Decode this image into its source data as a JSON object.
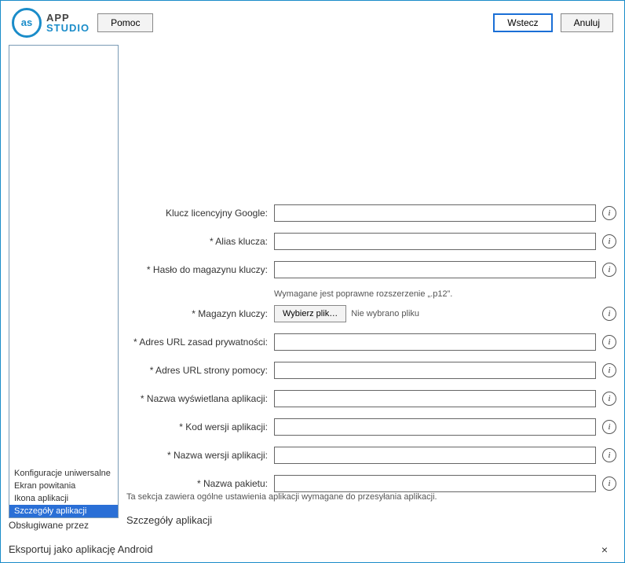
{
  "window": {
    "title": "Eksportuj jako aplikację Android"
  },
  "sidebar": {
    "label": "Obsługiwane przez",
    "items": [
      {
        "label": "Szczegóły aplikacji",
        "selected": true
      },
      {
        "label": "Ikona aplikacji"
      },
      {
        "label": "Ekran powitania"
      },
      {
        "label": "Konfiguracje uniwersalne"
      }
    ]
  },
  "section": {
    "title": "Szczegóły aplikacji",
    "description": "Ta sekcja zawiera ogólne ustawienia aplikacji wymagane do przesyłania aplikacji."
  },
  "fields": {
    "package_name": {
      "label": "* Nazwa pakietu:"
    },
    "version_name": {
      "label": "* Nazwa wersji aplikacji:"
    },
    "version_code": {
      "label": "* Kod wersji aplikacji:"
    },
    "display_name": {
      "label": "* Nazwa wyświetlana aplikacji:"
    },
    "help_url": {
      "label": "* Adres URL strony pomocy:"
    },
    "privacy_url": {
      "label": "* Adres URL zasad prywatności:"
    },
    "keystore": {
      "label": "* Magazyn kluczy:",
      "button": "Wybierz plik…",
      "status": "Nie wybrano pliku",
      "hint": "Wymagane jest poprawne rozszerzenie „.p12”."
    },
    "keystore_password": {
      "label": "* Hasło do magazynu kluczy:"
    },
    "key_alias": {
      "label": "* Alias klucza:"
    },
    "google_license_key": {
      "label": "Klucz licencyjny Google:"
    }
  },
  "buttons": {
    "help": "Pomoc",
    "back": "Wstecz",
    "cancel": "Anuluj"
  },
  "logo": {
    "badge": "as",
    "line1": "STUDIO",
    "line2": "APP"
  },
  "icons": {
    "info_glyph": "i",
    "close_glyph": "×"
  }
}
